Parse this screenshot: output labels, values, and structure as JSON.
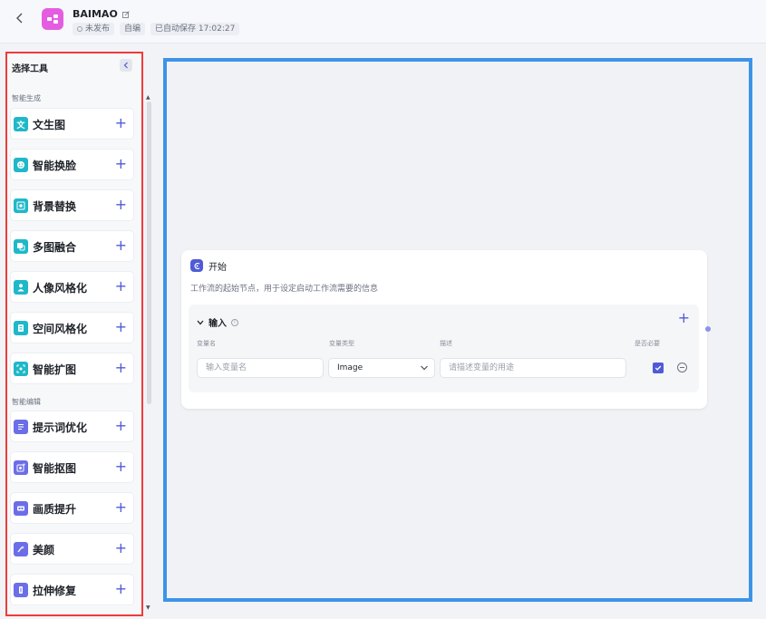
{
  "header": {
    "title": "BAIMAO",
    "status": "未发布",
    "mode": "自编",
    "autosave": "已自动保存 17:02:27"
  },
  "sidebar": {
    "title": "选择工具",
    "sections": [
      {
        "title": "智能生成",
        "items": [
          {
            "label": "文生图",
            "icon": "text-image-icon",
            "color": "#1fb8c9"
          },
          {
            "label": "智能换脸",
            "icon": "face-swap-icon",
            "color": "#1fb8c9"
          },
          {
            "label": "背景替换",
            "icon": "background-replace-icon",
            "color": "#1fb8c9"
          },
          {
            "label": "多图融合",
            "icon": "image-merge-icon",
            "color": "#1fb8c9"
          },
          {
            "label": "人像风格化",
            "icon": "portrait-style-icon",
            "color": "#1fb8c9"
          },
          {
            "label": "空间风格化",
            "icon": "space-style-icon",
            "color": "#1fb8c9"
          },
          {
            "label": "智能扩图",
            "icon": "image-expand-icon",
            "color": "#1fb8c9"
          }
        ]
      },
      {
        "title": "智能编辑",
        "items": [
          {
            "label": "提示词优化",
            "icon": "prompt-optimize-icon",
            "color": "#6b6ee8"
          },
          {
            "label": "智能抠图",
            "icon": "cutout-icon",
            "color": "#6b6ee8"
          },
          {
            "label": "画质提升",
            "icon": "quality-enhance-icon",
            "color": "#6b6ee8"
          },
          {
            "label": "美颜",
            "icon": "beauty-icon",
            "color": "#6b6ee8"
          },
          {
            "label": "拉伸修复",
            "icon": "stretch-repair-icon",
            "color": "#6b6ee8"
          }
        ]
      }
    ]
  },
  "node": {
    "title": "开始",
    "description": "工作流的起始节点，用于设定启动工作流需要的信息",
    "input_section": {
      "label": "输入",
      "columns": {
        "name": "变量名",
        "type": "变量类型",
        "desc": "描述",
        "required": "是否必要"
      },
      "row": {
        "name_placeholder": "输入变量名",
        "type_value": "Image",
        "desc_placeholder": "请描述变量的用途",
        "required": true
      }
    }
  },
  "colors": {
    "accent": "#4f5bd5",
    "sidebar_border": "#ee3b3b",
    "canvas_border": "#3d93e8",
    "app_icon": "#e45de0"
  }
}
